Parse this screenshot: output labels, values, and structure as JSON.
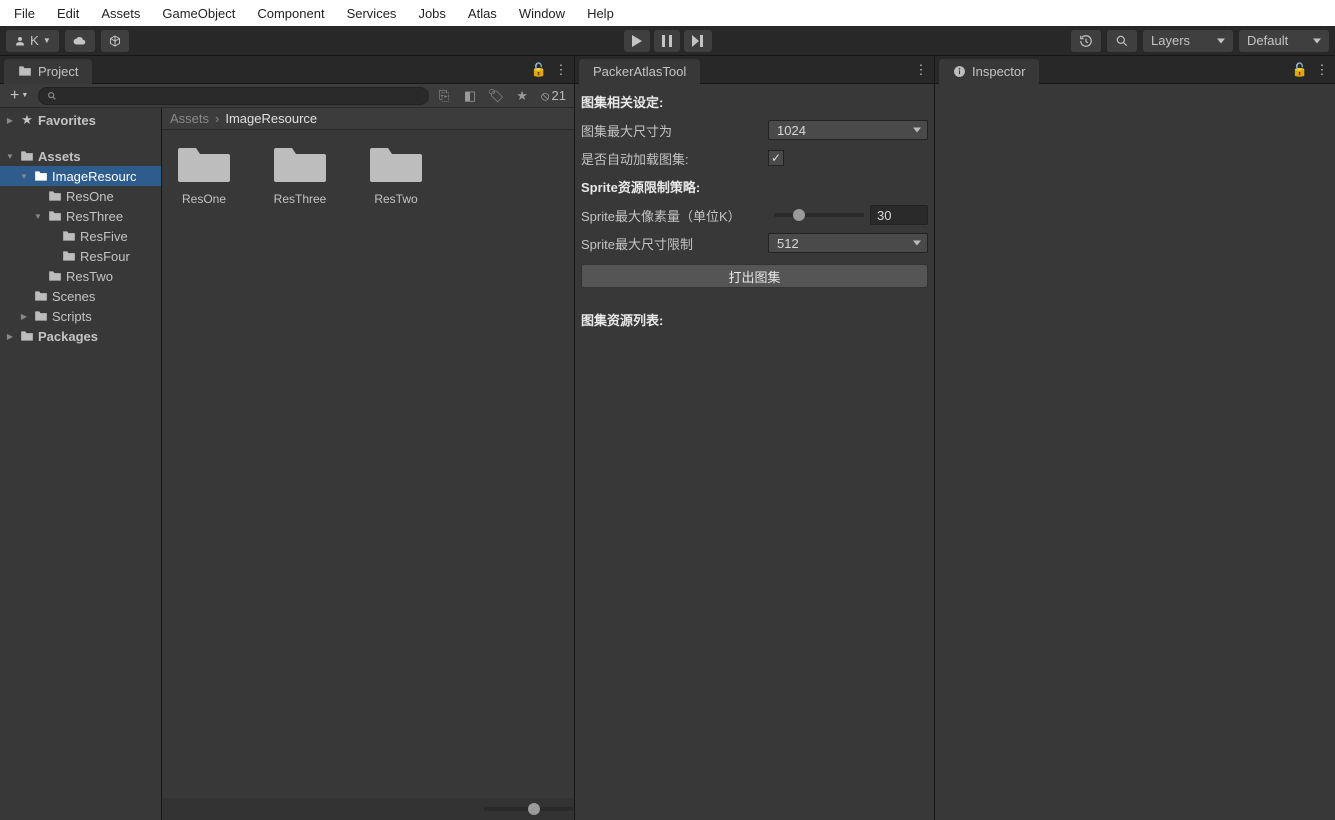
{
  "menubar": [
    "File",
    "Edit",
    "Assets",
    "GameObject",
    "Component",
    "Services",
    "Jobs",
    "Atlas",
    "Window",
    "Help"
  ],
  "toolbar": {
    "account_label": "K",
    "layers_label": "Layers",
    "layout_label": "Default"
  },
  "project": {
    "tab_label": "Project",
    "hidden_counter": "21",
    "search_placeholder": "",
    "tree": {
      "favorites": "Favorites",
      "assets": "Assets",
      "imageResource": "ImageResourc",
      "resOne": "ResOne",
      "resThree": "ResThree",
      "resFive": "ResFive",
      "resFour": "ResFour",
      "resTwo": "ResTwo",
      "scenes": "Scenes",
      "scripts": "Scripts",
      "packages": "Packages"
    },
    "breadcrumb": {
      "root": "Assets",
      "current": "ImageResource"
    },
    "grid_items": [
      "ResOne",
      "ResThree",
      "ResTwo"
    ]
  },
  "packer": {
    "tab_label": "PackerAtlasTool",
    "section1_title": "图集相关设定:",
    "max_size_label": "图集最大尺寸为",
    "max_size_value": "1024",
    "autoload_label": "是否自动加载图集:",
    "autoload_checked": "✓",
    "section2_title": "Sprite资源限制策略:",
    "sprite_max_pixels_label": "Sprite最大像素量（单位K）",
    "sprite_max_pixels_value": "30",
    "sprite_max_size_label": "Sprite最大尺寸限制",
    "sprite_max_size_value": "512",
    "build_button": "打出图集",
    "list_title": "图集资源列表:"
  },
  "inspector": {
    "tab_label": "Inspector"
  }
}
